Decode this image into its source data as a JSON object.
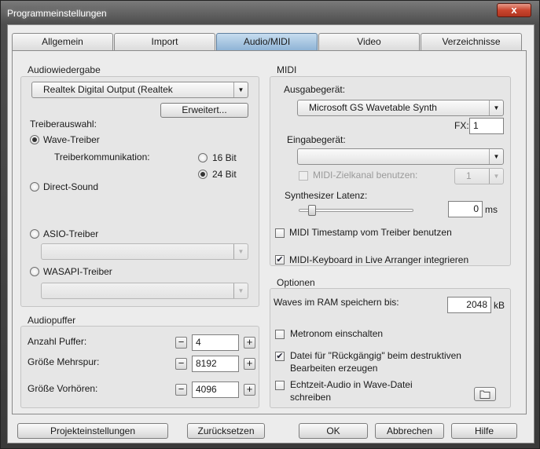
{
  "window": {
    "title": "Programmeinstellungen",
    "close_glyph": "x"
  },
  "tabs": [
    {
      "label": "Allgemein"
    },
    {
      "label": "Import"
    },
    {
      "label": "Audio/MIDI"
    },
    {
      "label": "Video"
    },
    {
      "label": "Verzeichnisse"
    }
  ],
  "active_tab": "Audio/MIDI",
  "audio": {
    "title": "Audiowiedergabe",
    "device": "Realtek Digital Output (Realtek",
    "erweitert_label": "Erweitert...",
    "treiberauswahl_label": "Treiberauswahl:",
    "wave_label": "Wave-Treiber",
    "kommunikation_label": "Treiberkommunikation:",
    "bit16_label": "16 Bit",
    "bit24_label": "24 Bit",
    "directsound_label": "Direct-Sound",
    "asio_label": "ASIO-Treiber",
    "wasapi_label": "WASAPI-Treiber"
  },
  "puffer": {
    "title": "Audiopuffer",
    "anzahl_label": "Anzahl Puffer:",
    "anzahl_value": "4",
    "mehrspur_label": "Größe Mehrspur:",
    "mehrspur_value": "8192",
    "vorhoeren_label": "Größe Vorhören:",
    "vorhoeren_value": "4096"
  },
  "midi": {
    "title": "MIDI",
    "ausgabe_label": "Ausgabegerät:",
    "ausgabe_value": "Microsoft GS Wavetable Synth",
    "fx_label": "FX:",
    "fx_value": "1",
    "eingabe_label": "Eingabegerät:",
    "eingabe_value": "",
    "zielkanal_label": "MIDI-Zielkanal benutzen:",
    "zielkanal_value": "1",
    "latenz_label": "Synthesizer Latenz:",
    "latenz_value": "0",
    "latenz_unit": "ms",
    "latenz_level": 0,
    "timestamp_label": "MIDI Timestamp vom Treiber benutzen",
    "keyboard_label": "MIDI-Keyboard in Live Arranger integrieren"
  },
  "optionen": {
    "title": "Optionen",
    "ram_label": "Waves im RAM speichern bis:",
    "ram_value": "2048",
    "ram_unit": "kB",
    "metronom_label": "Metronom einschalten",
    "rueckgaengig_label_line1": "Datei für \"Rückgängig\" beim destruktiven",
    "rueckgaengig_label_line2": "Bearbeiten erzeugen",
    "echtzeit_label_line1": "Echtzeit-Audio in Wave-Datei",
    "echtzeit_label_line2": "schreiben"
  },
  "buttons": {
    "projekt": "Projekteinstellungen",
    "zuruecksetzen": "Zurücksetzen",
    "ok": "OK",
    "abbrechen": "Abbrechen",
    "hilfe": "Hilfe"
  }
}
